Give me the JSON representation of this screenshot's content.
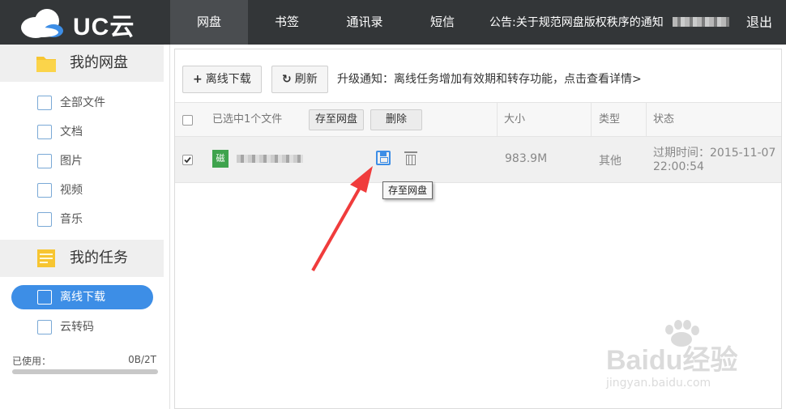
{
  "header": {
    "brand": "UC云",
    "nav": [
      "网盘",
      "书签",
      "通讯录",
      "短信"
    ],
    "active_nav": "网盘",
    "notice": "公告:关于规范网盘版权秩序的通知",
    "logout": "退出"
  },
  "sidebar": {
    "section1": "我的网盘",
    "files": [
      "全部文件",
      "文档",
      "图片",
      "视频",
      "音乐"
    ],
    "section2": "我的任务",
    "tasks": [
      "离线下载",
      "云转码"
    ],
    "active_task": "离线下载",
    "usage_label": "已使用：",
    "usage_value": "0B/2T",
    "usage_fraction": 0.0
  },
  "toolbar": {
    "offline_download": "离线下载",
    "refresh": "刷新",
    "upgrade_notice": "升级通知：离线任务增加有效期和转存功能，点击查看详情>"
  },
  "table": {
    "selected_text": "已选中1个文件",
    "save_button": "存至网盘",
    "delete_button": "删除",
    "columns": [
      "大小",
      "类型",
      "状态"
    ],
    "rows": [
      {
        "icon_text": "磁",
        "size": "983.9M",
        "type": "其他",
        "status_line1": "过期时间：2015-11-07",
        "status_line2": "22:00:54",
        "checked": true
      }
    ]
  },
  "tooltip": "存至网盘",
  "watermark": {
    "line1": "Baidu经验",
    "line2": "jingyan.baidu.com"
  },
  "colors": {
    "accent": "#3d8ee6",
    "topbar": "#333638",
    "arrow": "#f03c3c"
  }
}
